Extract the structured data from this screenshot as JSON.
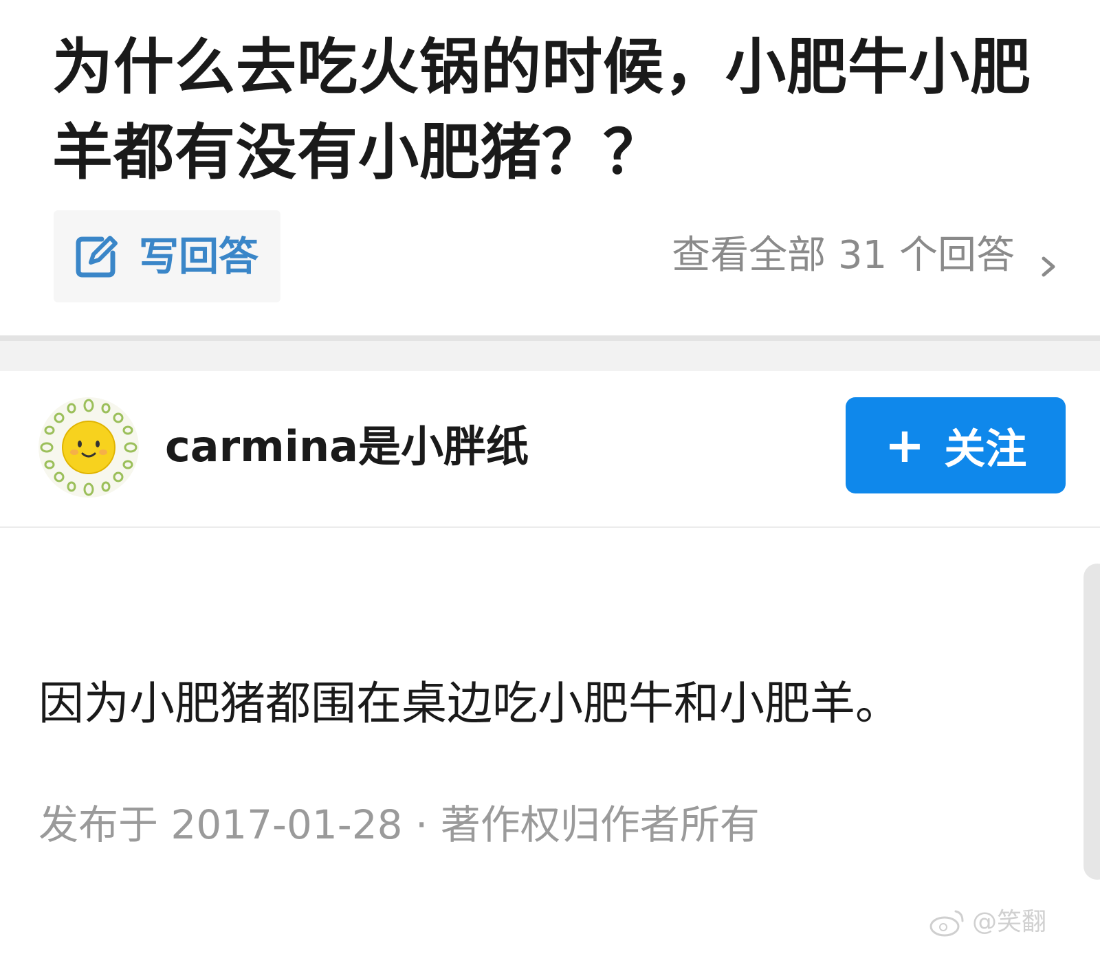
{
  "question": {
    "title": "为什么去吃火锅的时候，小肥牛小肥羊都有没有小肥猪？？"
  },
  "actions": {
    "write_answer_label": "写回答",
    "write_answer_icon": "edit-icon",
    "view_all_label": "查看全部 31 个回答",
    "view_all_icon": "chevron-right-icon"
  },
  "answer": {
    "author": {
      "name": "carmina是小胖纸",
      "avatar_icon": "sun-avatar"
    },
    "follow_label": "关注",
    "follow_icon": "plus-icon",
    "content": "因为小肥猪都围在桌边吃小肥牛和小肥羊。",
    "meta": "发布于 2017-01-28 · 著作权归作者所有"
  },
  "watermark": {
    "text": "@笑翻"
  },
  "colors": {
    "accent": "#0f88eb",
    "link_blue": "#3a86c8",
    "muted_text": "#8a8a8a",
    "section_bg": "#f2f2f2"
  }
}
